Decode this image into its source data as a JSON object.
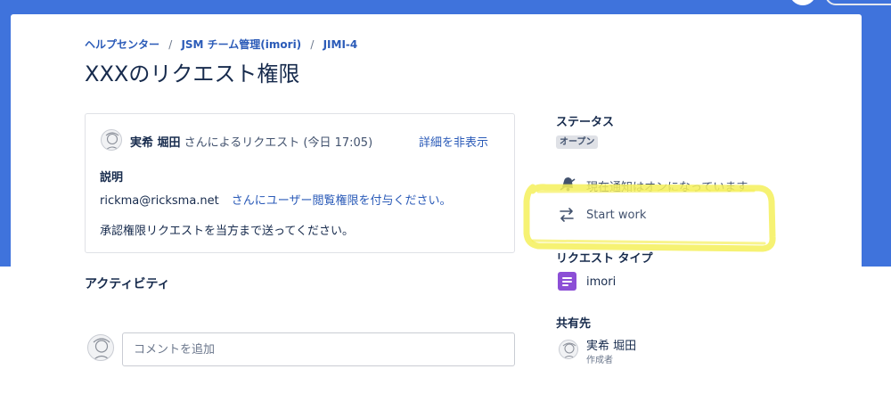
{
  "breadcrumb": {
    "items": [
      "ヘルプセンター",
      "JSM チーム管理(imori)",
      "JIMI-4"
    ],
    "separator": "/"
  },
  "page": {
    "title": "XXXのリクエスト権限"
  },
  "request": {
    "requester_name": "実希 堀田",
    "requested_text": " さんによるリクエスト (今日 17:05)",
    "toggle_details": "詳細を非表示",
    "description_label": "説明",
    "description_email": "rickma@ricksma.net",
    "description_highlight": "さんにユーザー閲覧権限を付与ください。",
    "description_line2": "承認権限リクエストを当方まで送ってください。"
  },
  "activity": {
    "title": "アクティビティ",
    "comment_placeholder": "コメントを追加"
  },
  "sidebar": {
    "status_label": "ステータス",
    "status_value": "オープン",
    "notification_text": "現在通知はオンになっています",
    "start_work": "Start work",
    "request_type_label": "リクエスト タイプ",
    "request_type_value": "imori",
    "shared_with_label": "共有先",
    "sharer_name": "実希 堀田",
    "sharer_role": "作成者"
  },
  "colors": {
    "header_blue": "#3f73dc",
    "link_blue": "#2b5bb8",
    "type_icon_purple": "#8c4fd6",
    "highlight_yellow": "#f5f05a"
  }
}
